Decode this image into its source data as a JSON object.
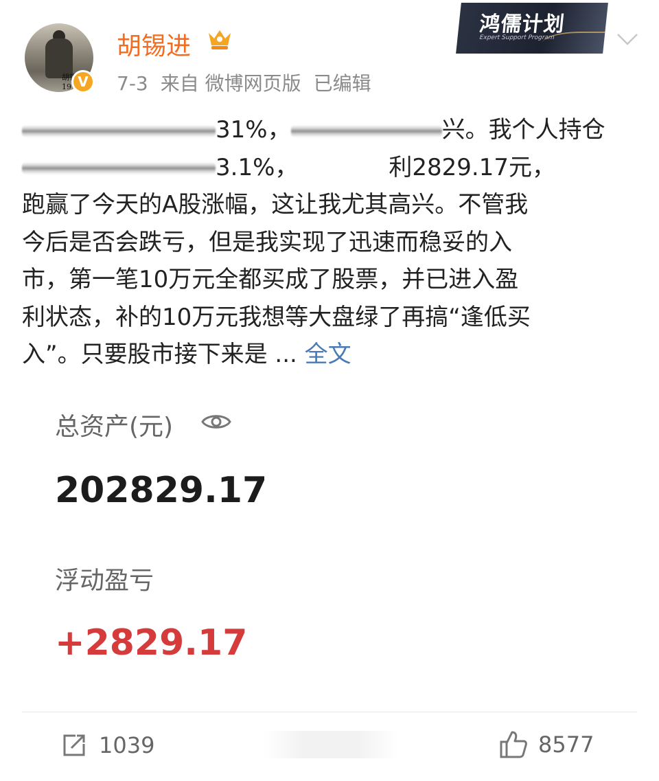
{
  "author": {
    "name": "胡锡进",
    "verified": "V",
    "avatar_mark": "胡锡进 19"
  },
  "meta": {
    "date": "7-3",
    "source": "来自 微博网页版",
    "edited": "已编辑"
  },
  "watermark": {
    "title": "鸿儒计划",
    "subtitle": "Expert Support Program"
  },
  "post": {
    "lines": [
      {
        "fragments": [
          "31%，",
          "兴。我个人持仓"
        ]
      },
      {
        "fragments": [
          "3.1%，",
          "利2829.17元，"
        ]
      },
      {
        "text": "跑赢了今天的A股涨幅，这让我尤其高兴。不管我"
      },
      {
        "text": "今后是否会跌亏，但是我实现了迅速而稳妥的入"
      },
      {
        "text": "市，第一笔10万元全都买成了股票，并已进入盈"
      },
      {
        "text": "利状态，补的10万元我想等大盘绿了再搞“逢低买"
      },
      {
        "text": "入”。只要股市接下来是 ..."
      }
    ],
    "full_text_link": "全文"
  },
  "image_card": {
    "total_assets_label": "总资产(元)",
    "total_assets_value": "202829.17",
    "floating_pnl_label": "浮动盈亏",
    "floating_pnl_value": "+2829.17"
  },
  "actions": {
    "repost_count": "1039",
    "like_count": "8577"
  },
  "colors": {
    "username": "#f26d1f",
    "link": "#4a7ab5",
    "profit": "#d63b3b",
    "meta_gray": "#8a8a8a"
  }
}
